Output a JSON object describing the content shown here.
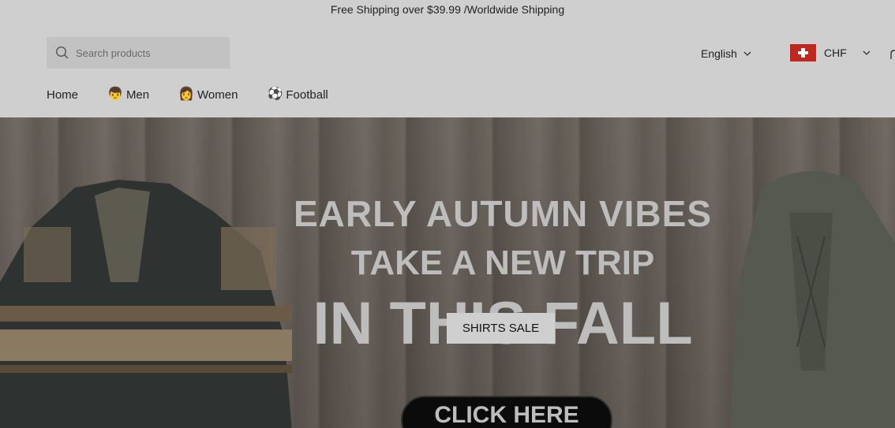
{
  "announcement": {
    "text": "Free Shipping over $39.99 /Worldwide Shipping"
  },
  "search": {
    "placeholder": "Search products",
    "value": "",
    "icon": "search-icon"
  },
  "language": {
    "label": "English",
    "icon": "chevron-down-icon"
  },
  "currency": {
    "label": "CHF",
    "flag": "switzerland-flag-icon",
    "icon": "chevron-down-icon"
  },
  "nav": {
    "items": [
      {
        "label": "Home",
        "emoji": ""
      },
      {
        "label": "Men",
        "emoji": "👦"
      },
      {
        "label": "Women",
        "emoji": "👩"
      },
      {
        "label": "Football",
        "emoji": "⚽"
      }
    ]
  },
  "hero": {
    "line1": "EARLY AUTUMN VIBES",
    "line2": "TAKE A NEW TRIP",
    "line3": "IN THIS FALL",
    "cta_label": "SHIRTS SALE",
    "image_button": "CLICK HERE"
  },
  "colors": {
    "header_bg": "#cfcfcf",
    "flag_red": "#c1271c",
    "hero_text": "#bdbdbd"
  }
}
